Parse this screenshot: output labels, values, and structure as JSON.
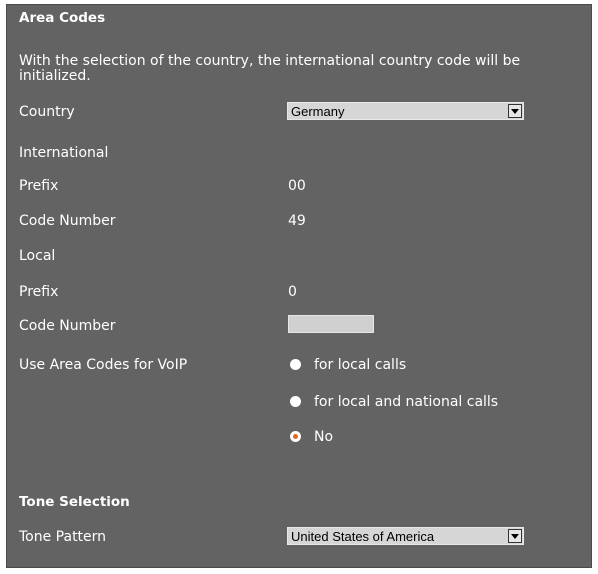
{
  "area_codes": {
    "heading": "Area Codes",
    "description": "With the selection of the country, the international country code will be initialized.",
    "country_label": "Country",
    "country_value": "Germany",
    "international_label": "International",
    "intl_prefix_label": "Prefix",
    "intl_prefix_value": "00",
    "intl_code_label": "Code Number",
    "intl_code_value": "49",
    "local_label": "Local",
    "local_prefix_label": "Prefix",
    "local_prefix_value": "0",
    "local_code_label": "Code Number",
    "local_code_value": "",
    "voip_label": "Use Area Codes for VoIP",
    "voip_options": [
      {
        "label": "for local calls",
        "checked": false
      },
      {
        "label": "for local and national calls",
        "checked": false
      },
      {
        "label": "No",
        "checked": true
      }
    ]
  },
  "tone_selection": {
    "heading": "Tone Selection",
    "pattern_label": "Tone Pattern",
    "pattern_value": "United States of America"
  },
  "colors": {
    "panel_bg": "#636363",
    "text": "#ffffff",
    "radio_selected": "#e8661c"
  }
}
